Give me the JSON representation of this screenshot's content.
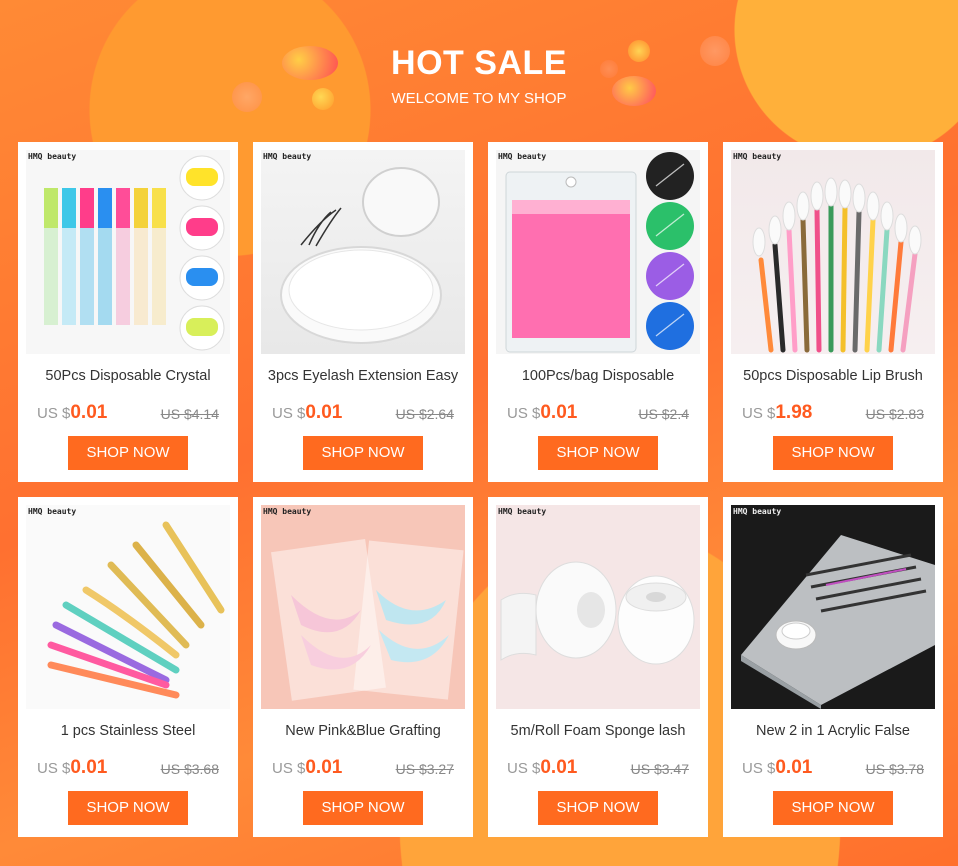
{
  "header": {
    "title": "HOT SALE",
    "subtitle": "WELCOME TO MY SHOP"
  },
  "colors": {
    "background": "#ff7a2f",
    "accent": "#ff6a1f",
    "price": "#ff5a1f"
  },
  "products": [
    {
      "brand": "HMQ beauty",
      "name": "50Pcs Disposable Crystal",
      "currency": "US $",
      "price": "0.01",
      "old_price": "US $4.14",
      "button": "SHOP NOW",
      "image_icon": "mascara-wands-image"
    },
    {
      "brand": "HMQ beauty",
      "name": "3pcs Eyelash Extension Easy",
      "currency": "US $",
      "price": "0.01",
      "old_price": "US $2.64",
      "button": "SHOP NOW",
      "image_icon": "crystal-pallet-image"
    },
    {
      "brand": "HMQ beauty",
      "name": "100Pcs/bag Disposable",
      "currency": "US $",
      "price": "0.01",
      "old_price": "US $2.4",
      "button": "SHOP NOW",
      "image_icon": "micro-brushes-image"
    },
    {
      "brand": "HMQ beauty",
      "name": "50pcs Disposable Lip Brush",
      "currency": "US $",
      "price": "1.98",
      "old_price": "US $2.83",
      "button": "SHOP NOW",
      "image_icon": "lip-brushes-image"
    },
    {
      "brand": "HMQ beauty",
      "name": "1 pcs Stainless Steel",
      "currency": "US $",
      "price": "0.01",
      "old_price": "US $3.68",
      "button": "SHOP NOW",
      "image_icon": "tweezers-image"
    },
    {
      "brand": "HMQ beauty",
      "name": "New Pink&Blue Grafting",
      "currency": "US $",
      "price": "0.01",
      "old_price": "US $3.27",
      "button": "SHOP NOW",
      "image_icon": "eye-pads-image"
    },
    {
      "brand": "HMQ beauty",
      "name": "5m/Roll Foam Sponge lash",
      "currency": "US $",
      "price": "0.01",
      "old_price": "US $3.47",
      "button": "SHOP NOW",
      "image_icon": "foam-tape-image"
    },
    {
      "brand": "HMQ beauty",
      "name": "New 2 in 1 Acrylic False",
      "currency": "US $",
      "price": "0.01",
      "old_price": "US $3.78",
      "button": "SHOP NOW",
      "image_icon": "acrylic-holder-image"
    }
  ]
}
